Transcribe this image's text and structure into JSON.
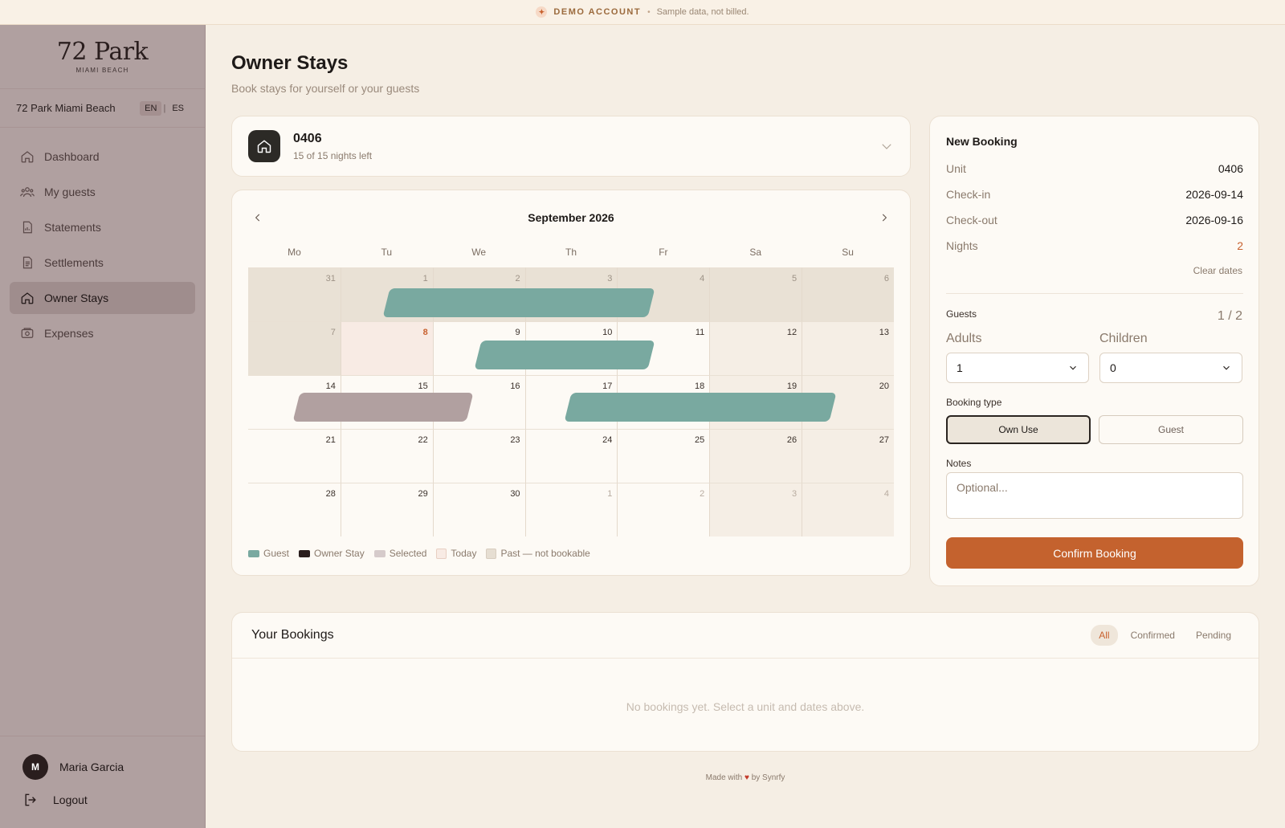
{
  "banner": {
    "label": "DEMO ACCOUNT",
    "separator": "•",
    "text": "Sample data, not billed."
  },
  "brand": {
    "name": "72 Park",
    "sub": "MIAMI BEACH"
  },
  "property": {
    "name": "72 Park Miami Beach",
    "lang_en": "EN",
    "lang_sep": "|",
    "lang_es": "ES"
  },
  "nav": [
    {
      "label": "Dashboard",
      "icon": "home-icon"
    },
    {
      "label": "My guests",
      "icon": "users-icon"
    },
    {
      "label": "Statements",
      "icon": "chart-file-icon"
    },
    {
      "label": "Settlements",
      "icon": "document-icon"
    },
    {
      "label": "Owner Stays",
      "icon": "home-icon",
      "active": true
    },
    {
      "label": "Expenses",
      "icon": "wallet-icon"
    }
  ],
  "user": {
    "initial": "M",
    "name": "Maria Garcia",
    "logout": "Logout"
  },
  "page": {
    "title": "Owner Stays",
    "subtitle": "Book stays for yourself or your guests"
  },
  "unit": {
    "number": "0406",
    "nights_left": "15 of 15 nights left"
  },
  "calendar": {
    "month": "September 2026",
    "weekdays": [
      "Mo",
      "Tu",
      "We",
      "Th",
      "Fr",
      "Sa",
      "Su"
    ],
    "weeks": [
      [
        "31",
        "1",
        "2",
        "3",
        "4",
        "5",
        "6"
      ],
      [
        "7",
        "8",
        "9",
        "10",
        "11",
        "12",
        "13"
      ],
      [
        "14",
        "15",
        "16",
        "17",
        "18",
        "19",
        "20"
      ],
      [
        "21",
        "22",
        "23",
        "24",
        "25",
        "26",
        "27"
      ],
      [
        "28",
        "29",
        "30",
        "1",
        "2",
        "3",
        "4"
      ]
    ],
    "today": "8",
    "legend": {
      "guest": "Guest",
      "owner": "Owner Stay",
      "selected": "Selected",
      "today": "Today",
      "past": "Past — not bookable"
    },
    "colors": {
      "guest": "#79a9a0",
      "owner": "#2a1e1e",
      "selected": "#b1a0a0",
      "accent": "#c8612e"
    }
  },
  "booking": {
    "title": "New Booking",
    "unit_label": "Unit",
    "unit_value": "0406",
    "checkin_label": "Check-in",
    "checkin_value": "2026-09-14",
    "checkout_label": "Check-out",
    "checkout_value": "2026-09-16",
    "nights_label": "Nights",
    "nights_value": "2",
    "clear": "Clear dates",
    "guests_label": "Guests",
    "guests_count": "1 / 2",
    "adults_label": "Adults",
    "adults_value": "1",
    "children_label": "Children",
    "children_value": "0",
    "type_label": "Booking type",
    "type_own": "Own Use",
    "type_guest": "Guest",
    "notes_label": "Notes",
    "notes_placeholder": "Optional...",
    "confirm": "Confirm Booking"
  },
  "bookings": {
    "title": "Your Bookings",
    "filters": [
      "All",
      "Confirmed",
      "Pending"
    ],
    "empty": "No bookings yet. Select a unit and dates above."
  },
  "footer": {
    "pre": "Made with",
    "heart": "♥",
    "post": "by Synrfy"
  }
}
